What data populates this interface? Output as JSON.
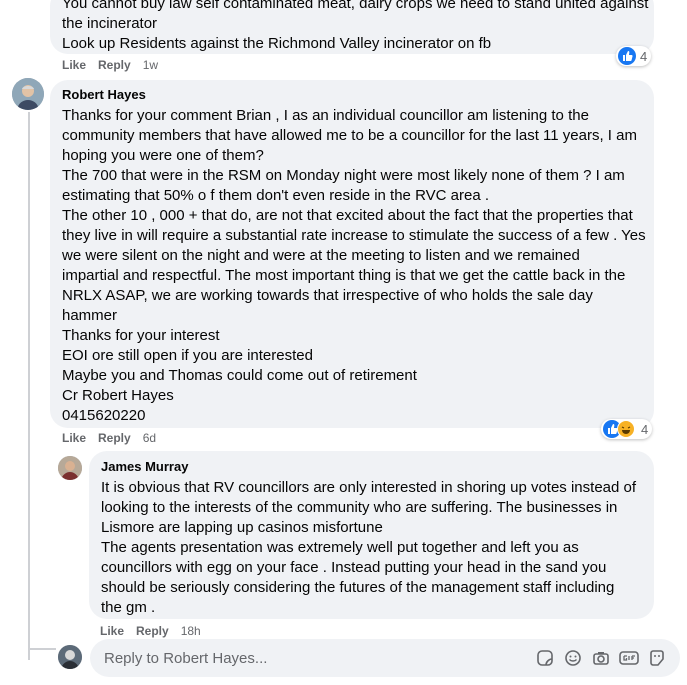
{
  "comments": [
    {
      "author": "",
      "lines": [
        "You cannot buy law self contaminated meat, dairy crops we need to stand united against",
        "the incinerator",
        "Look up Residents against the Richmond Valley incinerator on fb"
      ],
      "actions": {
        "like": "Like",
        "reply": "Reply",
        "time": "1w"
      },
      "reaction_count": "4"
    },
    {
      "author": "Robert Hayes",
      "lines": [
        "Thanks for your comment Brian , I as an individual councillor am listening to the",
        "community members that have allowed me to be a councillor for the last 11 years, I am",
        "hoping you were one of them?",
        "The 700 that were in the RSM on Monday night were most likely none of them ? I am",
        "estimating that 50% o f them don't even reside in the RVC area .",
        "The other 10 , 000 + that do, are not that excited about the fact that the properties that",
        "they live in will require a substantial rate increase to stimulate the success of a few . Yes",
        "we were silent on the night and were at the meeting to listen and we remained",
        "impartial and respectful. The most important thing is that we get the cattle back in the",
        "NRLX ASAP, we are working towards that irrespective of who holds the sale day",
        "hammer",
        "Thanks for your interest",
        "EOI ore still open if you are interested",
        "Maybe you and Thomas could come out of retirement",
        "Cr Robert Hayes",
        "0415620220"
      ],
      "actions": {
        "like": "Like",
        "reply": "Reply",
        "time": "6d"
      },
      "reaction_count": "4"
    },
    {
      "author": "James Murray",
      "lines": [
        "It is obvious that RV councillors are only interested in shoring up votes instead of",
        "looking to the interests of the community who are suffering. The businesses in",
        "Lismore are lapping up casinos misfortune",
        "The agents presentation was extremely well put together and left you as",
        "councillors with egg on your face . Instead putting your head in the sand you",
        "should be seriously considering the futures of the management staff including",
        "the gm ."
      ],
      "actions": {
        "like": "Like",
        "reply": "Reply",
        "time": "18h"
      }
    }
  ],
  "reply_box": {
    "placeholder": "Reply to Robert Hayes..."
  },
  "icons": {
    "reply_tools": [
      "sticker-icon",
      "emoji-icon",
      "camera-icon",
      "gif-icon",
      "avatar-sticker-icon"
    ]
  },
  "colors": {
    "bubble": "#f0f2f5",
    "like": "#1877f2",
    "meta": "#65676b"
  }
}
